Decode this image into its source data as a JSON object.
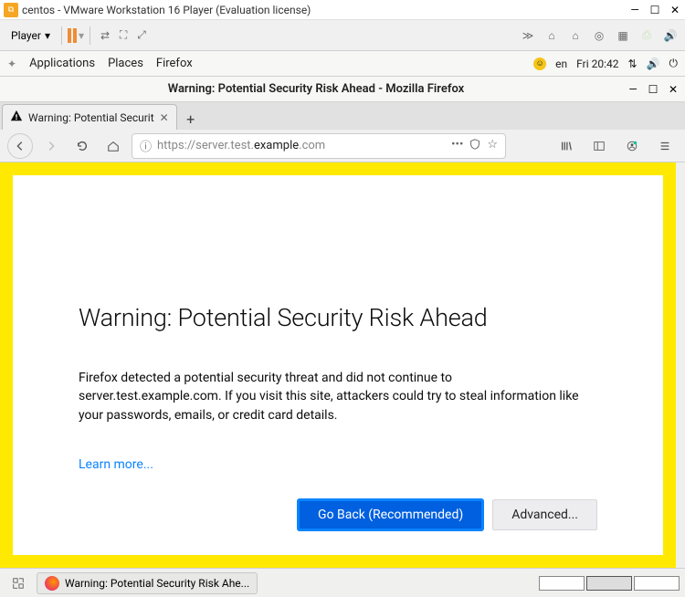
{
  "vmware": {
    "title": "centos - VMware Workstation 16 Player (Evaluation license)",
    "player": "Player"
  },
  "gnome": {
    "applications": "Applications",
    "places": "Places",
    "app_name": "Firefox",
    "lang": "en",
    "clock": "Fri 20:42"
  },
  "firefox": {
    "window_title": "Warning: Potential Security Risk Ahead - Mozilla Firefox",
    "tab_title": "Warning: Potential Securit",
    "url_prefix": "https://server.test.",
    "url_bold": "example",
    "url_suffix": ".com"
  },
  "page": {
    "heading": "Warning: Potential Security Risk Ahead",
    "body": "Firefox detected a potential security threat and did not continue to server.test.example.com. If you visit this site, attackers could try to steal information like your passwords, emails, or credit card details.",
    "learn_more": "Learn more...",
    "go_back": "Go Back (Recommended)",
    "advanced": "Advanced..."
  },
  "taskbar": {
    "window_label": "Warning: Potential Security Risk Ahe..."
  }
}
